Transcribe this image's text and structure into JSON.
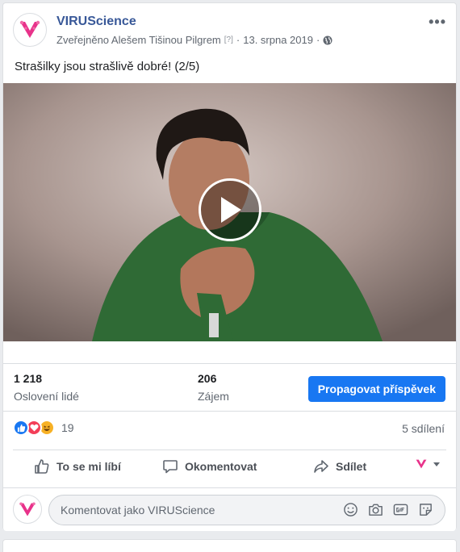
{
  "post": {
    "page_name": "VIRUScience",
    "published_by": "Zveřejněno Alešem Tišinou Pilgrem",
    "help_marker": "[?]",
    "separator": "·",
    "date": "13. srpna 2019",
    "text": "Strašilky jsou strašlivě dobré! (2/5)"
  },
  "stats": {
    "reach_value": "1 218",
    "reach_label": "Oslovení lidé",
    "engagement_value": "206",
    "engagement_label": "Zájem",
    "boost_label": "Propagovat příspěvek"
  },
  "reactions": {
    "count": "19",
    "shares": "5 sdílení",
    "icons": [
      "like-icon",
      "love-icon",
      "haha-icon"
    ]
  },
  "actions": {
    "like": "To se mi líbí",
    "comment": "Okomentovat",
    "share": "Sdílet"
  },
  "comment_box": {
    "placeholder": "Komentovat jako VIRUScience",
    "icons": [
      "emoji-icon",
      "camera-icon",
      "gif-icon",
      "sticker-icon"
    ]
  },
  "colors": {
    "brand_link": "#385898",
    "boost_button": "#1877f2",
    "logo": "#e8328a"
  }
}
